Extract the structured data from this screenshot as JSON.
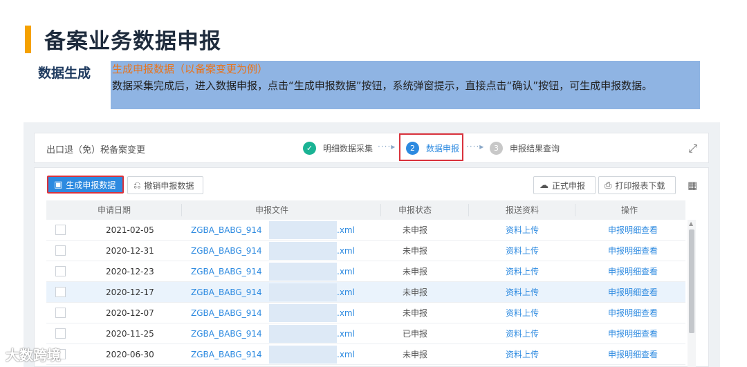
{
  "slide": {
    "title": "备案业务数据申报",
    "section_label": "数据生成",
    "highlight_title": "生成申报数据（以备案变更为例）",
    "highlight_desc": "数据采集完成后，进入数据申报，点击“生成申报数据”按钮，系统弹窗提示，直接点击“确认”按钮，可生成申报数据。"
  },
  "app": {
    "page_name": "出口退（免）税备案变更",
    "steps": [
      {
        "num": "✓",
        "label": "明细数据采集"
      },
      {
        "num": "2",
        "label": "数据申报"
      },
      {
        "num": "3",
        "label": "申报结果查询"
      }
    ],
    "arrow": "····▸",
    "toolbar": {
      "generate_label": "生成申报数据",
      "cancel_label": "撤销申报数据",
      "submit_label": "正式申报",
      "print_label": "打印报表下载"
    },
    "table": {
      "headers": [
        "申请日期",
        "申报文件",
        "申报状态",
        "报送资料",
        "操作"
      ],
      "rows": [
        {
          "date": "2021-02-05",
          "file": "ZGBA_BABG_914",
          "ext": ".xml",
          "status": "未申报",
          "upload": "资料上传",
          "detail": "申报明细查看"
        },
        {
          "date": "2020-12-31",
          "file": "ZGBA_BABG_914",
          "ext": ".xml",
          "status": "未申报",
          "upload": "资料上传",
          "detail": "申报明细查看"
        },
        {
          "date": "2020-12-23",
          "file": "ZGBA_BABG_914",
          "ext": ".xml",
          "status": "未申报",
          "upload": "资料上传",
          "detail": "申报明细查看"
        },
        {
          "date": "2020-12-17",
          "file": "ZGBA_BABG_914",
          "ext": ".xml",
          "status": "未申报",
          "upload": "资料上传",
          "detail": "申报明细查看"
        },
        {
          "date": "2020-12-07",
          "file": "ZGBA_BABG_914",
          "ext": ".xml",
          "status": "未申报",
          "upload": "资料上传",
          "detail": "申报明细查看"
        },
        {
          "date": "2020-11-25",
          "file": "ZGBA_BABG_914",
          "ext": ".xml",
          "status": "已申报",
          "upload": "资料上传",
          "detail": "申报明细查看"
        },
        {
          "date": "2020-06-30",
          "file": "ZGBA_BABG_914",
          "ext": ".xml",
          "status": "未申报",
          "upload": "资料上传",
          "detail": "申报明细查看"
        }
      ]
    }
  },
  "watermark": "大数跨境",
  "colors": {
    "accent": "#f5a100",
    "primary": "#2d8ae0",
    "highlight_bg": "#8fb4e3",
    "alert": "#d9323c"
  }
}
